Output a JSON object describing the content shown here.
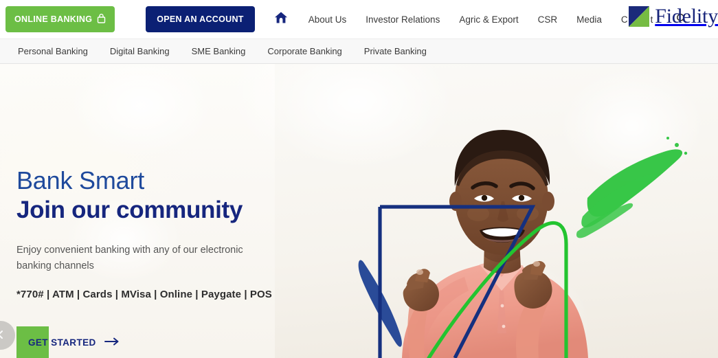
{
  "header": {
    "online_banking_label": "ONLINE BANKING",
    "online_banking_icon": "padlock-icon",
    "open_account_label": "OPEN AN ACCOUNT",
    "home_icon": "home-icon",
    "search_icon": "search-icon",
    "nav_items": [
      {
        "label": "About Us"
      },
      {
        "label": "Investor Relations"
      },
      {
        "label": "Agric & Export"
      },
      {
        "label": "CSR"
      },
      {
        "label": "Media"
      },
      {
        "label": "Contact"
      }
    ],
    "brand": {
      "name": "Fidelity",
      "mark_icon": "fidelity-logo-mark"
    }
  },
  "subnav": {
    "items": [
      {
        "label": "Personal Banking"
      },
      {
        "label": "Digital Banking"
      },
      {
        "label": "SME Banking"
      },
      {
        "label": "Corporate Banking"
      },
      {
        "label": "Private Banking"
      }
    ]
  },
  "hero": {
    "kicker": "Bank Smart",
    "title": "Join our community",
    "subtitle": "Enjoy convenient banking with any of our electronic banking channels",
    "channels": "*770# | ATM | Cards | MVisa | Online | Paygate | POS",
    "cta_label": "GET STARTED",
    "cta_arrow": "arrow-right-icon",
    "prev_icon": "chevron-left-icon"
  },
  "colors": {
    "navy": "#0b2074",
    "green": "#6cbe45",
    "bright_green": "#27c23c",
    "heading_blue": "#16267e",
    "kicker_blue": "#1f4a9c",
    "shirt_pink": "#f0a193"
  }
}
